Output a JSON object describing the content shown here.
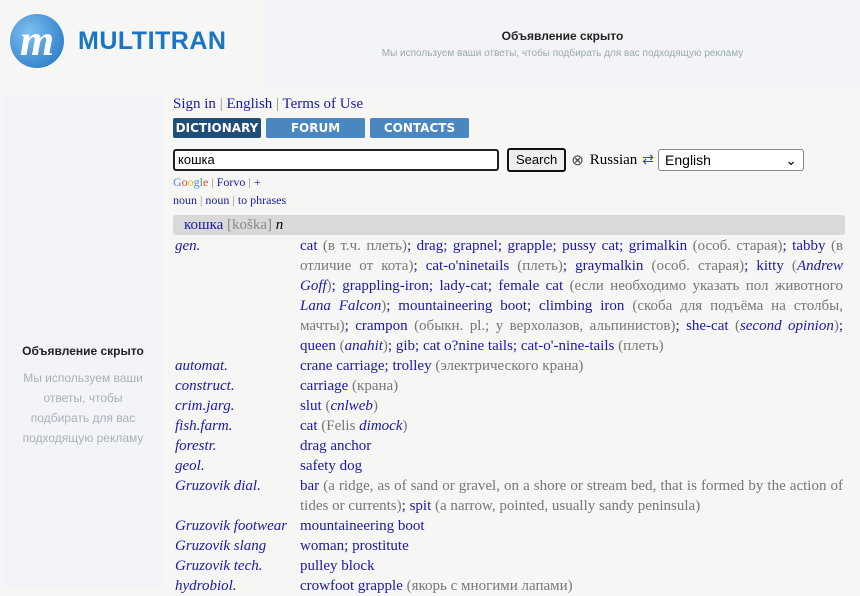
{
  "logo": {
    "text": "MULTITRAN",
    "mark": "m"
  },
  "ad_top": {
    "title": "Объявление скрыто",
    "subtitle": "Мы используем ваши ответы, чтобы подбирать для вас подходящую рекламу"
  },
  "ad_left": {
    "title": "Объявление скрыто",
    "subtitle": "Мы используем ваши ответы, чтобы подбирать для вас подходящую рекламу"
  },
  "toplinks": {
    "sign_in": "Sign in",
    "english": "English",
    "terms": "Terms of Use"
  },
  "tabs": [
    {
      "label": "DICTIONARY",
      "active": true
    },
    {
      "label": "FORUM"
    },
    {
      "label": "CONTACTS"
    }
  ],
  "search": {
    "value": "кошка",
    "button": "Search",
    "clear_icon": "circled-x-icon",
    "source_lang": "Russian",
    "swap_icon": "swap-arrows-icon",
    "target_lang": "English"
  },
  "extlinks": {
    "google": "Google",
    "forvo": "Forvo",
    "plus": "+"
  },
  "pos_links": [
    "noun",
    "noun",
    "to phrases"
  ],
  "entry": {
    "word": "кошка",
    "transcription": "[koška]",
    "pos": "n"
  },
  "rows": [
    {
      "subject": "gen.",
      "segments": [
        [
          "l",
          "cat"
        ],
        [
          "n",
          " (в т.ч. плеть)"
        ],
        [
          "s",
          "; "
        ],
        [
          "l",
          "drag"
        ],
        [
          "s",
          "; "
        ],
        [
          "l",
          "grapnel"
        ],
        [
          "s",
          "; "
        ],
        [
          "l",
          "grapple"
        ],
        [
          "s",
          "; "
        ],
        [
          "l",
          "pussy cat"
        ],
        [
          "s",
          "; "
        ],
        [
          "l",
          "grimalkin"
        ],
        [
          "n",
          " (особ. старая)"
        ],
        [
          "s",
          "; "
        ],
        [
          "l",
          "tabby"
        ],
        [
          "n",
          " (в отличие от кота)"
        ],
        [
          "s",
          "; "
        ],
        [
          "l",
          "cat-o'ninetails"
        ],
        [
          "n",
          " (плеть)"
        ],
        [
          "s",
          "; "
        ],
        [
          "l",
          "graymalkin"
        ],
        [
          "n",
          " (особ. старая)"
        ],
        [
          "s",
          "; "
        ],
        [
          "l",
          "kitty"
        ],
        [
          "n",
          " ("
        ],
        [
          "a",
          "Andrew Goff"
        ],
        [
          "n",
          ")"
        ],
        [
          "s",
          "; "
        ],
        [
          "l",
          "grappling-iron"
        ],
        [
          "s",
          "; "
        ],
        [
          "l",
          "lady-cat"
        ],
        [
          "s",
          "; "
        ],
        [
          "l",
          "female cat"
        ],
        [
          "n",
          " (если необходимо указать пол животного "
        ],
        [
          "a",
          "Lana Falcon"
        ],
        [
          "n",
          ")"
        ],
        [
          "s",
          "; "
        ],
        [
          "l",
          "mountaineering boot"
        ],
        [
          "s",
          "; "
        ],
        [
          "l",
          "climbing iron"
        ],
        [
          "n",
          " (скоба для подъёма на столбы, мачты)"
        ],
        [
          "s",
          "; "
        ],
        [
          "l",
          "crampon"
        ],
        [
          "n",
          " (обыкн. pl.; у верхолазов, альпинистов)"
        ],
        [
          "s",
          "; "
        ],
        [
          "l",
          "she-cat"
        ],
        [
          "n",
          " ("
        ],
        [
          "a",
          "second opinion"
        ],
        [
          "n",
          ")"
        ],
        [
          "s",
          "; "
        ],
        [
          "l",
          "queen"
        ],
        [
          "n",
          " ("
        ],
        [
          "a",
          "anahit"
        ],
        [
          "n",
          ")"
        ],
        [
          "s",
          "; "
        ],
        [
          "l",
          "gib"
        ],
        [
          "s",
          "; "
        ],
        [
          "l",
          "cat o?nine tails"
        ],
        [
          "s",
          "; "
        ],
        [
          "l",
          "cat-o'-nine-tails"
        ],
        [
          "n",
          " (плеть)"
        ]
      ]
    },
    {
      "subject": "automat.",
      "segments": [
        [
          "l",
          "crane carriage"
        ],
        [
          "s",
          "; "
        ],
        [
          "l",
          "trolley"
        ],
        [
          "n",
          " (электрического крана)"
        ]
      ]
    },
    {
      "subject": "construct.",
      "segments": [
        [
          "l",
          "carriage"
        ],
        [
          "n",
          " (крана)"
        ]
      ]
    },
    {
      "subject": "crim.jarg.",
      "segments": [
        [
          "l",
          "slut"
        ],
        [
          "n",
          " ("
        ],
        [
          "a",
          "cnlweb"
        ],
        [
          "n",
          ")"
        ]
      ]
    },
    {
      "subject": "fish.farm.",
      "segments": [
        [
          "l",
          "cat"
        ],
        [
          "n",
          " (Felis "
        ],
        [
          "a",
          "dimock"
        ],
        [
          "n",
          ")"
        ]
      ]
    },
    {
      "subject": "forestr.",
      "segments": [
        [
          "l",
          "drag anchor"
        ]
      ]
    },
    {
      "subject": "geol.",
      "segments": [
        [
          "l",
          "safety dog"
        ]
      ]
    },
    {
      "subject": "Gruzovik dial.",
      "segments": [
        [
          "l",
          "bar"
        ],
        [
          "n",
          " (a ridge, as of sand or gravel, on a shore or stream bed, that is formed by the action of tides or currents)"
        ],
        [
          "s",
          "; "
        ],
        [
          "l",
          "spit"
        ],
        [
          "n",
          " (a narrow, pointed, usually sandy peninsula)"
        ]
      ]
    },
    {
      "subject": "Gruzovik footwear",
      "segments": [
        [
          "l",
          "mountaineering boot"
        ]
      ]
    },
    {
      "subject": "Gruzovik slang",
      "segments": [
        [
          "l",
          "woman"
        ],
        [
          "s",
          "; "
        ],
        [
          "l",
          "prostitute"
        ]
      ]
    },
    {
      "subject": "Gruzovik tech.",
      "segments": [
        [
          "l",
          "pulley block"
        ]
      ]
    },
    {
      "subject": "hydrobiol.",
      "segments": [
        [
          "l",
          "crowfoot grapple"
        ],
        [
          "n",
          " (якорь с многими лапами)"
        ]
      ]
    }
  ]
}
